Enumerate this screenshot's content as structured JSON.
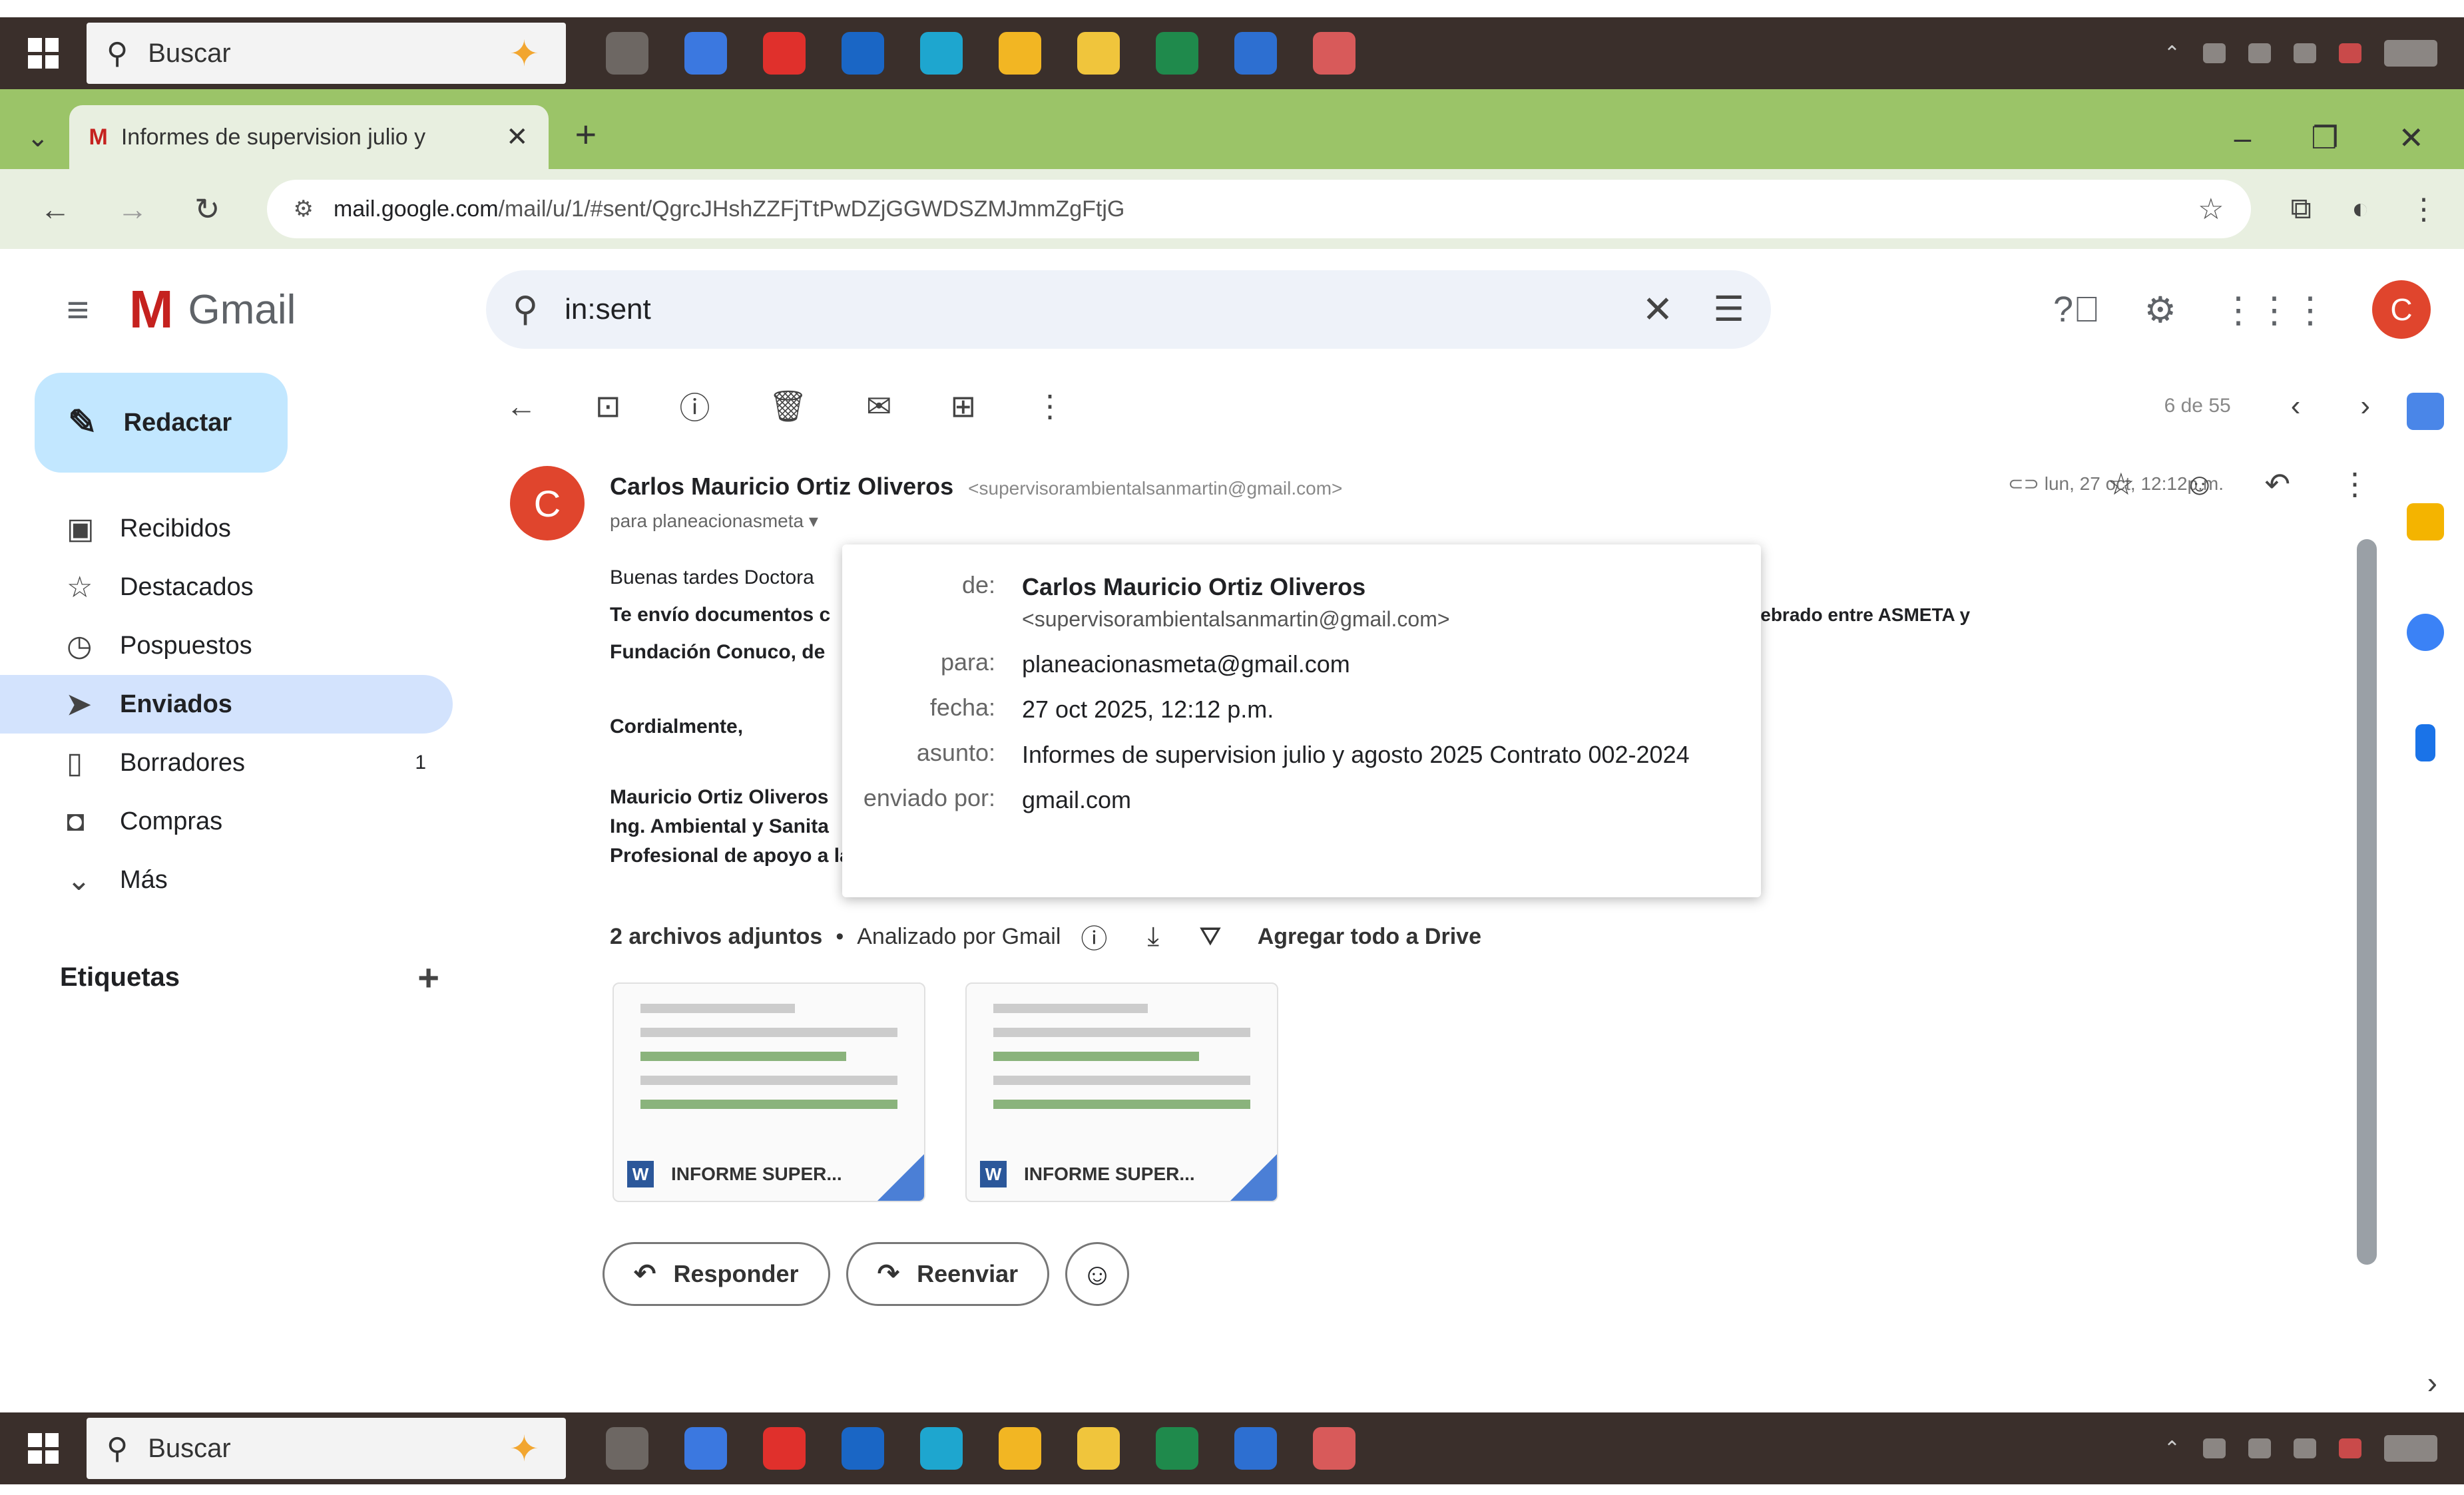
{
  "taskbar": {
    "search_label": "Buscar",
    "search_icon": "search-icon",
    "apps": [
      {
        "name": "taskview-icon",
        "color": "#6d6763"
      },
      {
        "name": "copilot-icon",
        "color": "#3b78e0"
      },
      {
        "name": "opera-icon",
        "color": "#e0302c"
      },
      {
        "name": "outlook-icon",
        "color": "#1a66c5"
      },
      {
        "name": "edge-icon",
        "color": "#1ea6cf"
      },
      {
        "name": "chrome-icon",
        "color": "#f2b623"
      },
      {
        "name": "file-explorer-icon",
        "color": "#f0c53c"
      },
      {
        "name": "excel-icon",
        "color": "#1f8a4c"
      },
      {
        "name": "word-icon",
        "color": "#2d6fd1"
      },
      {
        "name": "chrome-profile-icon",
        "color": "#d85a5a"
      }
    ]
  },
  "browser": {
    "tab_title": "Informes de supervision julio y",
    "url_domain": "mail.google.com",
    "url_path": "/mail/u/1/#sent/QgrcJHshZZFjTtPwDZjGGWDSZMJmmZgFtjG"
  },
  "gmail": {
    "logo_text": "Gmail",
    "search_value": "in:sent",
    "compose_label": "Redactar",
    "nav": [
      {
        "label": "Recibidos",
        "icon": "inbox-icon",
        "glyph": "▣",
        "count": ""
      },
      {
        "label": "Destacados",
        "icon": "star-icon",
        "glyph": "☆",
        "count": ""
      },
      {
        "label": "Pospuestos",
        "icon": "clock-icon",
        "glyph": "◷",
        "count": ""
      },
      {
        "label": "Enviados",
        "icon": "send-icon",
        "glyph": "➤",
        "count": "",
        "active": true
      },
      {
        "label": "Borradores",
        "icon": "draft-icon",
        "glyph": "▯",
        "count": "1"
      },
      {
        "label": "Compras",
        "icon": "shopping-icon",
        "glyph": "◘",
        "count": ""
      },
      {
        "label": "Más",
        "icon": "chevron-down-icon",
        "glyph": "⌄",
        "count": ""
      }
    ],
    "labels_title": "Etiquetas",
    "pager": "6 de 55"
  },
  "message": {
    "avatar_letter": "C",
    "sender_name": "Carlos Mauricio Ortiz Oliveros",
    "sender_email": "<supervisorambientalsanmartin@gmail.com>",
    "to_line": "para planeacionasmeta",
    "date": "lun, 27 oct, 12:12p.m.",
    "body": {
      "greeting": "Buenas tardes Doctora",
      "line2_start": "Te envío documentos c",
      "line2_end": "colaboración 002-2024 celebrado entre ASMETA y",
      "line3": "Fundación Conuco, de",
      "closing": "Cordialmente,",
      "sig1": "Mauricio Ortiz Oliveros",
      "sig2": "Ing. Ambiental y Sanita",
      "sig3": "Profesional de apoyo a la Supervisión"
    },
    "attachments_title": "2 archivos adjuntos",
    "attachments_scanned": "Analizado por Gmail",
    "add_to_drive": "Agregar todo a Drive",
    "attachments": [
      {
        "name": "INFORME SUPER..."
      },
      {
        "name": "INFORME SUPER..."
      }
    ],
    "reply_label": "Responder",
    "forward_label": "Reenviar"
  },
  "details_popup": {
    "from_key": "de:",
    "from_name": "Carlos Mauricio Ortiz Oliveros",
    "from_email": "<supervisorambientalsanmartin@gmail.com>",
    "to_key": "para:",
    "to_value": "planeacionasmeta@gmail.com",
    "date_key": "fecha:",
    "date_value": "27 oct 2025, 12:12 p.m.",
    "subject_key": "asunto:",
    "subject_value": "Informes de supervision julio y agosto 2025 Contrato 002-2024",
    "sent_by_key": "enviado por:",
    "sent_by_value": "gmail.com"
  },
  "colors": {
    "chrome_frame": "#9bc468",
    "gmail_red": "#e0452d",
    "compose_bg": "#c2e7ff",
    "active_nav": "#d3e3fd"
  }
}
